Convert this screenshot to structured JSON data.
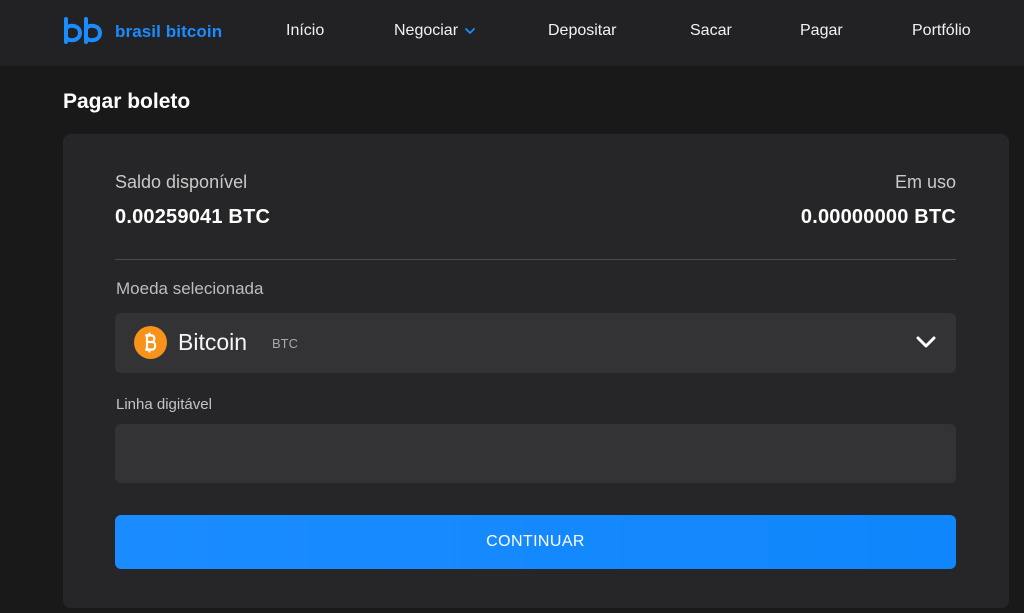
{
  "brand": {
    "name": "brasil bitcoin",
    "color": "#1a8cff"
  },
  "nav": {
    "items": [
      {
        "label": "Início"
      },
      {
        "label": "Negociar",
        "has_dropdown": true
      },
      {
        "label": "Depositar"
      },
      {
        "label": "Sacar"
      },
      {
        "label": "Pagar"
      },
      {
        "label": "Portfólio"
      }
    ]
  },
  "page": {
    "title": "Pagar boleto"
  },
  "balances": {
    "available_label": "Saldo disponível",
    "available_value": "0.00259041 BTC",
    "in_use_label": "Em uso",
    "in_use_value": "0.00000000 BTC"
  },
  "currency": {
    "label": "Moeda selecionada",
    "selected_name": "Bitcoin",
    "selected_symbol": "BTC",
    "icon": "bitcoin-icon",
    "icon_color": "#f7931a"
  },
  "barcode_field": {
    "label": "Linha digitável",
    "value": "",
    "placeholder": ""
  },
  "actions": {
    "continue_label": "CONTINUAR"
  },
  "colors": {
    "accent": "#1a8cff",
    "background": "#19191a",
    "card": "#262628",
    "field": "#333335"
  }
}
